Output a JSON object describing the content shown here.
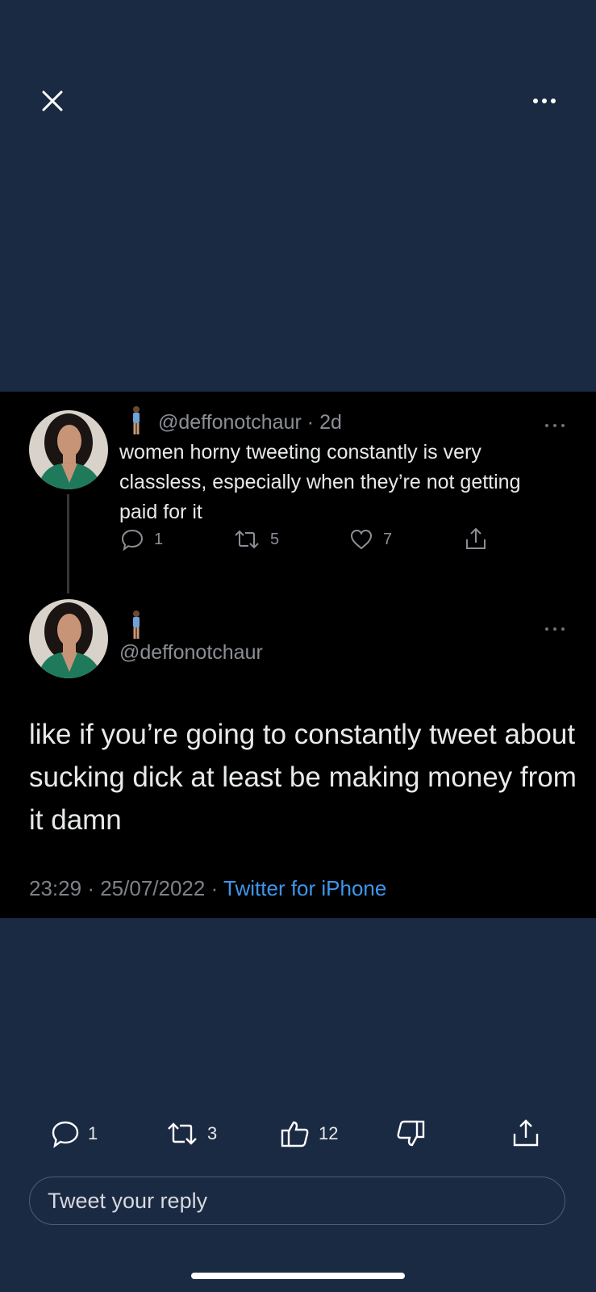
{
  "quoted_tweet": {
    "handle": "@deffonotchaur",
    "separator": "·",
    "age": "2d",
    "text": "women horny tweeting constantly is very classless, especially when they’re not getting paid for it",
    "reply_count": "1",
    "retweet_count": "5",
    "like_count": "7"
  },
  "main_tweet": {
    "handle": "@deffonotchaur",
    "text": "like if you’re going to constantly tweet about sucking dick at least be making money from it damn",
    "time": "23:29",
    "date": "25/07/2022",
    "separator": "·",
    "source": "Twitter for iPhone"
  },
  "bottom_bar": {
    "reply_count": "1",
    "retweet_count": "3",
    "like_count": "12"
  },
  "reply_input": {
    "placeholder": "Tweet your reply"
  },
  "colors": {
    "background": "#1b2a43",
    "card": "#000000",
    "link": "#3d96ec",
    "muted": "#8b8f95"
  }
}
